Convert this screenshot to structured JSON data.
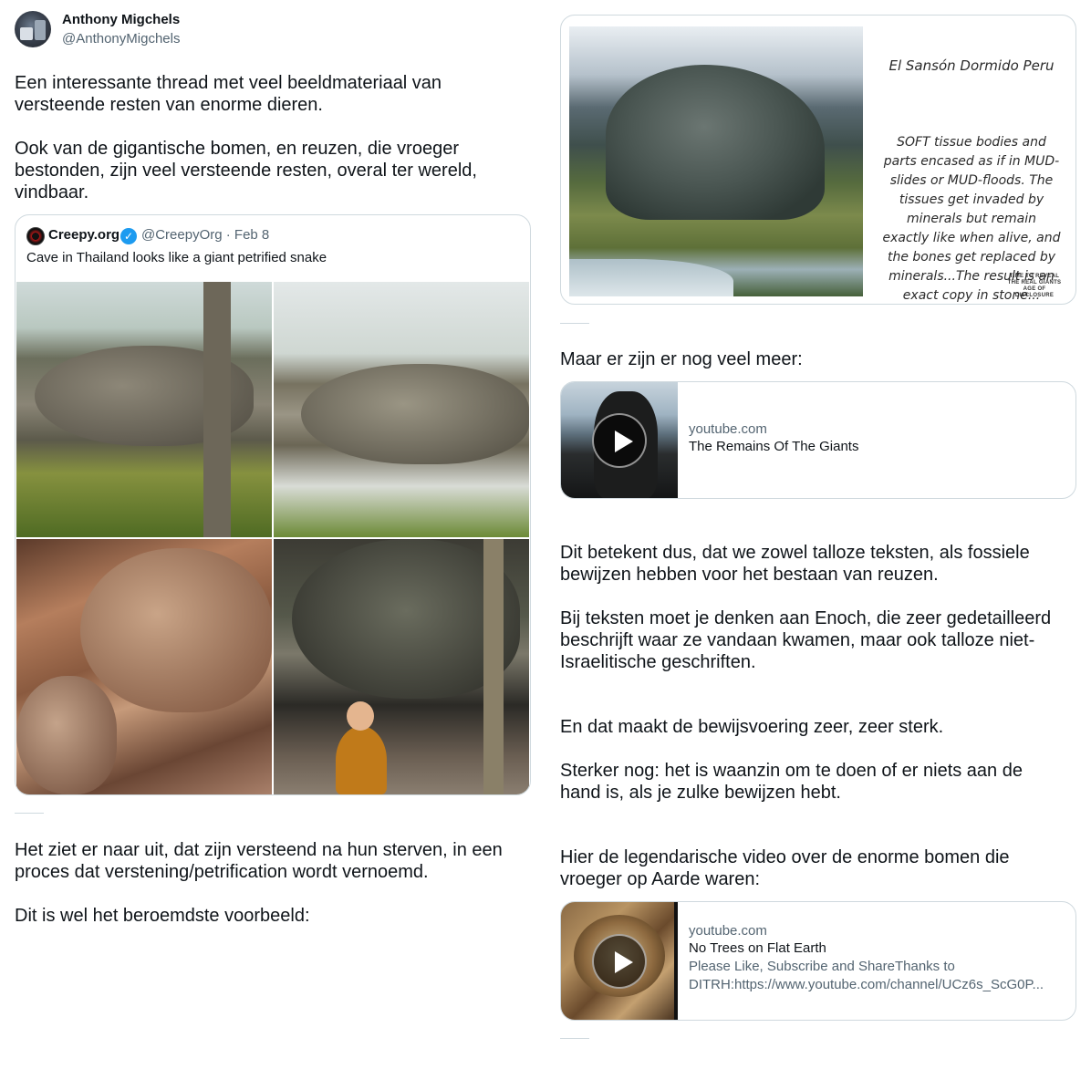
{
  "author": {
    "name": "Anthony Migchels",
    "handle": "@AnthonyMigchels"
  },
  "left": {
    "paragraph1": "Een interessante thread met veel beeldmateriaal van\nversteende resten van enorme dieren.",
    "paragraph2": "Ook van de gigantische bomen, en reuzen, die vroeger\nbestonden, zijn veel versteende resten, overal  ter wereld,\nvindbaar.",
    "quote": {
      "name": "Creepy.org",
      "handle_date": "@CreepyOrg · Feb 8",
      "text": "Cave in Thailand looks like a giant petrified snake"
    },
    "paragraph3": "Het ziet er naar uit, dat zijn versteend na hun sterven, in een\nproces dat verstening/petrification wordt vernoemd.",
    "paragraph4": "Dit is wel het beroemdste voorbeeld:"
  },
  "right": {
    "image_card": {
      "title": "El Sansón Dormido Peru",
      "body": "SOFT tissue bodies and\nparts encased as if in MUD-\nslides or MUD-floods. The\ntissues get invaded by\nminerals but remain\nexactly like when alive, and\nthe bones get replaced by\nminerals...The result is an\nexact copy in stone...",
      "stamp": "TIME TO REVEAL THE REAL GIANTS AGE OF DISCLOSURE"
    },
    "paragraph1": "Maar er zijn er nog veel meer:",
    "link1": {
      "domain": "youtube.com",
      "title": "The Remains Of The Giants"
    },
    "paragraph2": "Dit betekent dus, dat we zowel talloze teksten, als fossiele\nbewijzen hebben voor het bestaan van reuzen.",
    "paragraph3": "Bij teksten moet je denken aan Enoch, die zeer gedetailleerd\nbeschrijft waar ze vandaan kwamen, maar ook talloze niet-\nIsraelitische geschriften.",
    "paragraph4": "En dat maakt de bewijsvoering zeer, zeer sterk.",
    "paragraph5": "Sterker nog: het is waanzin om te doen of er niets aan de\nhand is, als je zulke bewijzen hebt.",
    "paragraph6": "Hier de legendarische video over de enorme bomen die\nvroeger op Aarde waren:",
    "link2": {
      "domain": "youtube.com",
      "title": "No Trees on Flat Earth",
      "desc_line1": "Please Like, Subscribe and ShareThanks to",
      "desc_line2": "DITRH:https://www.youtube.com/channel/UCz6s_ScG0P..."
    }
  },
  "colors": {
    "text": "#0f1419",
    "secondary": "#536471",
    "border": "#cfd9de",
    "verified": "#1d9bf0"
  },
  "icons": [
    "avatar",
    "creepy-logo-icon",
    "verified-badge-icon",
    "play-icon"
  ]
}
